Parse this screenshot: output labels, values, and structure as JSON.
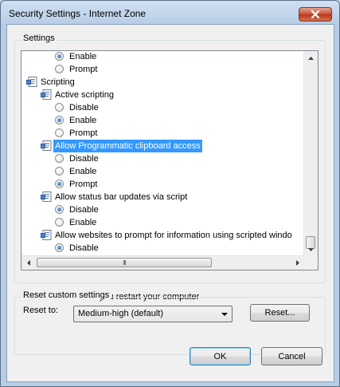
{
  "window": {
    "title": "Security Settings - Internet Zone",
    "close_icon": "close-icon"
  },
  "settings_group": {
    "label": "Settings",
    "tree": [
      {
        "kind": "radio",
        "label": "Enable",
        "checked": true
      },
      {
        "kind": "radio",
        "label": "Prompt",
        "checked": false
      },
      {
        "kind": "category",
        "label": "Scripting",
        "icon": "settings-category-icon"
      },
      {
        "kind": "setting",
        "label": "Active scripting",
        "icon": "setting-icon"
      },
      {
        "kind": "radio",
        "label": "Disable",
        "checked": false
      },
      {
        "kind": "radio",
        "label": "Enable",
        "checked": true
      },
      {
        "kind": "radio",
        "label": "Prompt",
        "checked": false
      },
      {
        "kind": "setting",
        "label": "Allow Programmatic clipboard access",
        "icon": "setting-icon",
        "selected": true
      },
      {
        "kind": "radio",
        "label": "Disable",
        "checked": false
      },
      {
        "kind": "radio",
        "label": "Enable",
        "checked": false
      },
      {
        "kind": "radio",
        "label": "Prompt",
        "checked": true
      },
      {
        "kind": "setting",
        "label": "Allow status bar updates via script",
        "icon": "setting-icon"
      },
      {
        "kind": "radio",
        "label": "Disable",
        "checked": true
      },
      {
        "kind": "radio",
        "label": "Enable",
        "checked": false
      },
      {
        "kind": "setting",
        "label": "Allow websites to prompt for information using scripted windo",
        "icon": "setting-icon"
      },
      {
        "kind": "radio",
        "label": "Disable",
        "checked": true
      }
    ],
    "hscroll_grip": "III",
    "note": "*Takes effect after you restart your computer"
  },
  "reset_group": {
    "label": "Reset custom settings",
    "reset_to_label": "Reset to:",
    "reset_to_value": "Medium-high (default)",
    "reset_button": "Reset..."
  },
  "footer": {
    "ok": "OK",
    "cancel": "Cancel"
  }
}
